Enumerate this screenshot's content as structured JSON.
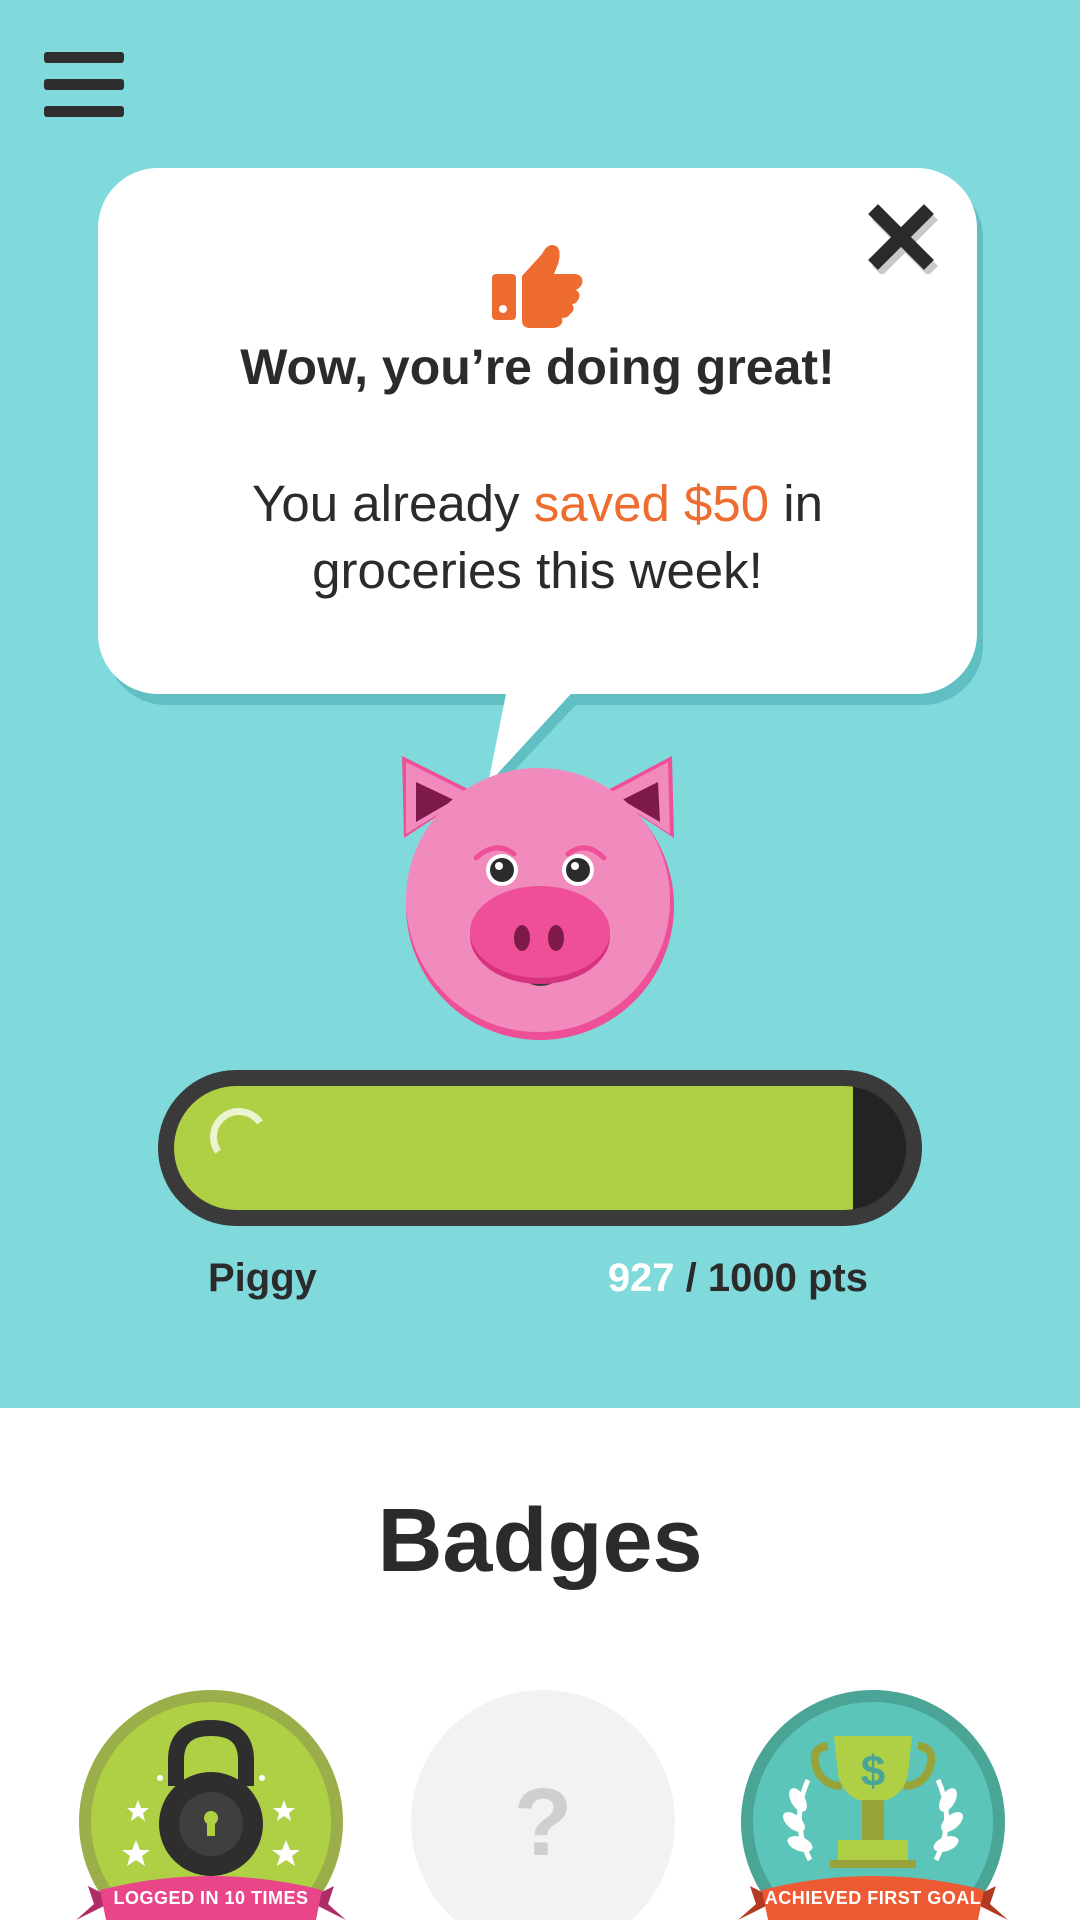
{
  "header": {
    "menu_icon": "hamburger-menu-icon"
  },
  "popup": {
    "icon": "thumbs-up-icon",
    "close_icon": "close-icon",
    "title": "Wow, you’re doing great!",
    "message_prefix": "You already ",
    "message_highlight": "saved $50",
    "message_suffix": " in groceries this week!",
    "accent_color": "#ee6c2f"
  },
  "mascot": {
    "icon": "pig-mascot-icon"
  },
  "progress": {
    "level_name": "Piggy",
    "current_points": "927",
    "points_suffix": " / 1000 pts",
    "fraction": 0.927,
    "fill_color": "#afd045"
  },
  "badges": {
    "title": "Badges",
    "items": [
      {
        "label": "LOGGED IN 10 TIMES",
        "icon": "padlock-icon",
        "color": "#afd045",
        "ribbon": "#e9468a"
      },
      {
        "label": "?",
        "icon": "locked-badge-icon",
        "color": "#f2f2f2"
      },
      {
        "label": "ACHIEVED FIRST GOAL",
        "icon": "trophy-icon",
        "color": "#5cc5b9",
        "ribbon": "#ee5a33"
      }
    ]
  },
  "colors": {
    "background": "#80dadc",
    "text": "#2b2b2b"
  }
}
